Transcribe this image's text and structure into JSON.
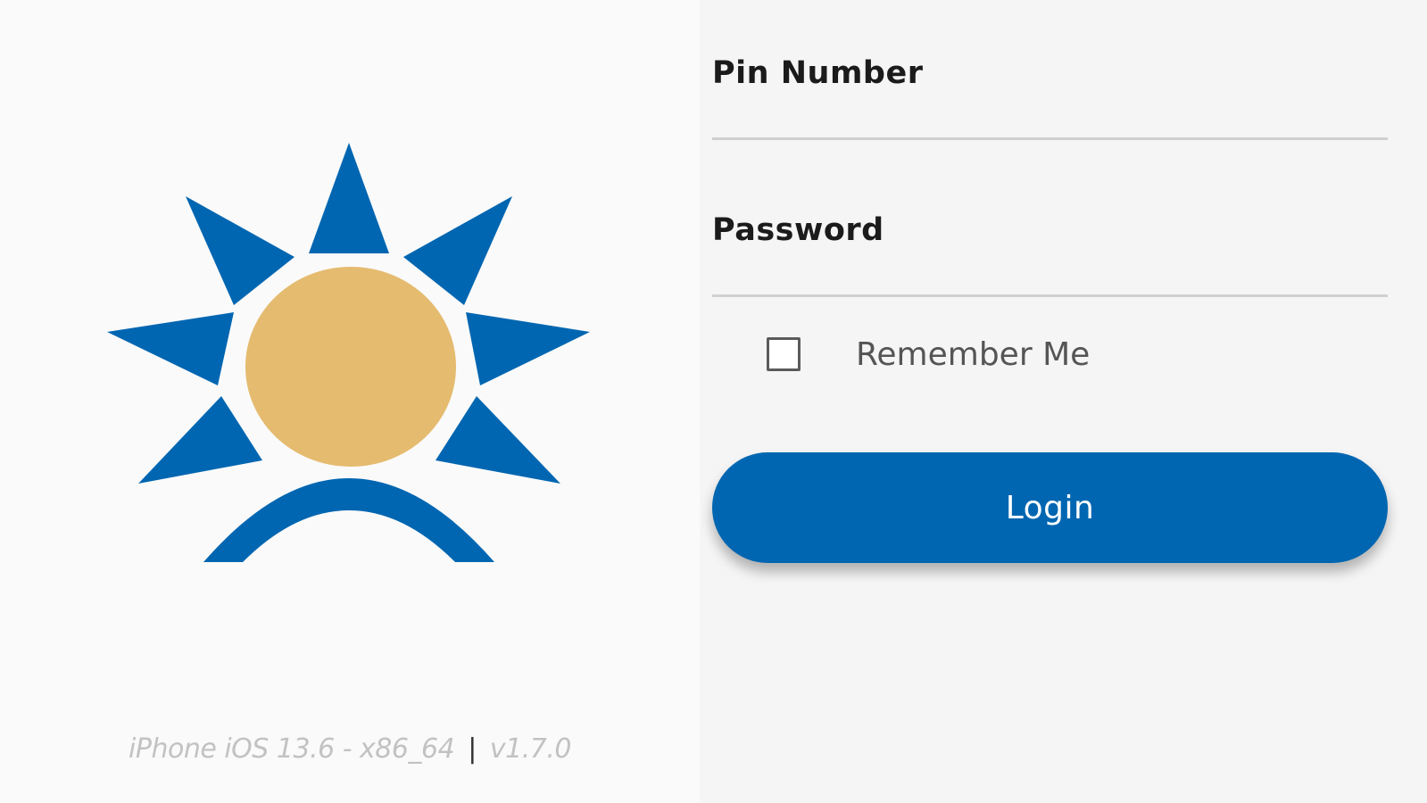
{
  "brand": {
    "logo_name": "sun-logo",
    "primary_color": "#0066b1",
    "sun_color": "#e5bb70"
  },
  "footer": {
    "device": "iPhone iOS 13.6 - x86_64",
    "separator": "|",
    "version": "v1.7.0"
  },
  "form": {
    "pin_label": "Pin Number",
    "pin_value": "",
    "password_label": "Password",
    "password_value": "",
    "remember_label": "Remember Me",
    "remember_checked": false,
    "login_label": "Login"
  }
}
